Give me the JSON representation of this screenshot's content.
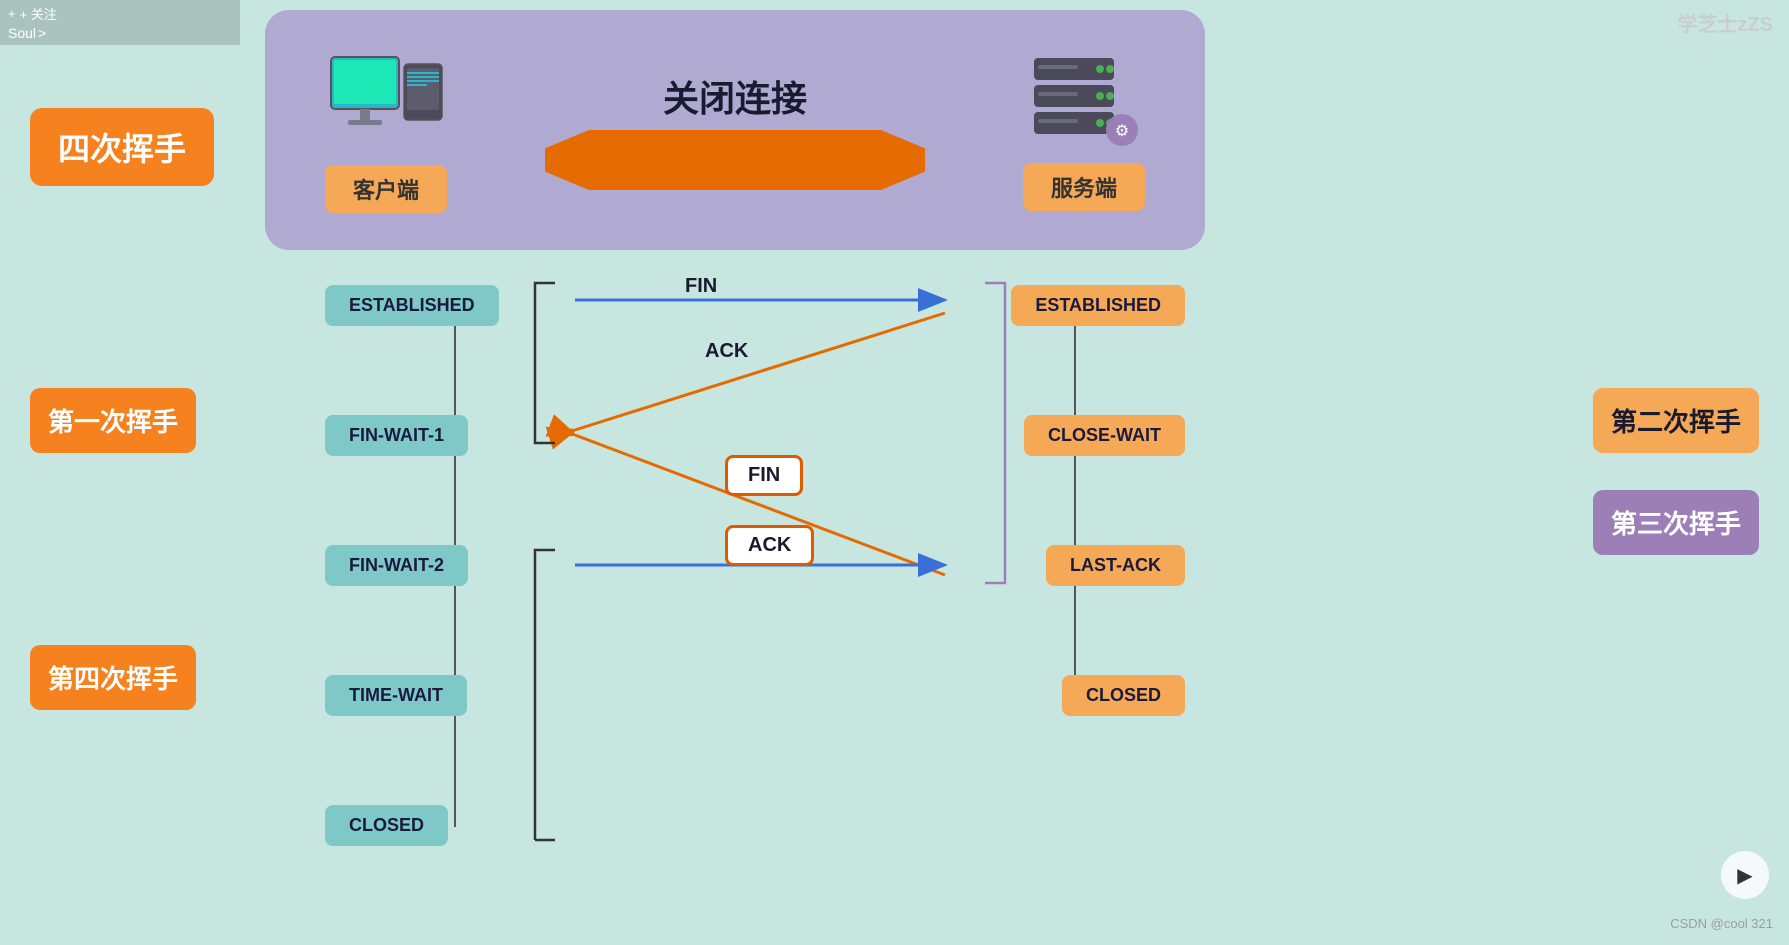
{
  "topBar": {
    "follow": "+ 关注",
    "soul": "Soul",
    "chevron": ">"
  },
  "watermark": "学芝士zZS",
  "mainTitle": "四次挥手",
  "topDiagram": {
    "title": "关闭连接",
    "clientLabel": "客户端",
    "serverLabel": "服务端"
  },
  "states": {
    "establishedLeft": "ESTABLISHED",
    "finWait1": "FIN-WAIT-1",
    "finWait2": "FIN-WAIT-2",
    "timeWait": "TIME-WAIT",
    "closedLeft": "CLOSED",
    "establishedRight": "ESTABLISHED",
    "closeWait": "CLOSE-WAIT",
    "lastAck": "LAST-ACK",
    "closedRight": "CLOSED"
  },
  "messages": {
    "fin1": "FIN",
    "ack1": "ACK",
    "fin2": "FIN",
    "ack2": "ACK"
  },
  "handshakes": {
    "first": "第一次挥手",
    "second": "第二次挥手",
    "third": "第三次挥手",
    "fourth": "第四次挥手"
  },
  "csdn": "CSDN @cool 321",
  "playBtn": "▶"
}
